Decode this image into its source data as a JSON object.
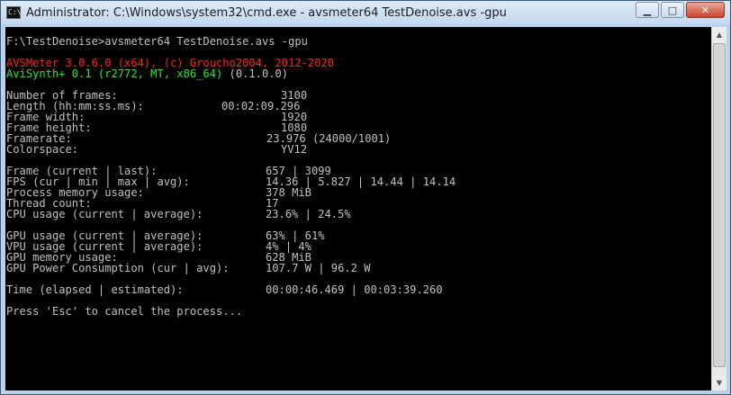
{
  "window": {
    "title": "Administrator: C:\\Windows\\system32\\cmd.exe - avsmeter64  TestDenoise.avs -gpu",
    "icon_text": "C:\\_",
    "controls": {
      "minimize": "▁",
      "maximize": "□",
      "close": "✕"
    }
  },
  "console": {
    "prompt_line": "F:\\TestDenoise>avsmeter64 TestDenoise.avs -gpu",
    "banner_red": "AVSMeter 3.0.6.0 (x64), (c) Groucho2004, 2012-2020",
    "banner_green": "AviSynth+ 0.1 (r2772, MT, x86_64)",
    "banner_version": " (0.1.0.0)",
    "info": [
      {
        "label": "Number of frames:",
        "value": "3100"
      },
      {
        "label": "Length (hh:mm:ss.ms):",
        "value": "00:02:09.296"
      },
      {
        "label": "Frame width:",
        "value": "1920"
      },
      {
        "label": "Frame height:",
        "value": "1080"
      },
      {
        "label": "Framerate:",
        "value": "23.976 (24000/1001)"
      },
      {
        "label": "Colorspace:",
        "value": "YV12"
      }
    ],
    "stats": [
      {
        "label": "Frame (current | last):",
        "value": "657 | 3099"
      },
      {
        "label": "FPS (cur | min | max | avg):",
        "value": "14.36 | 5.827 | 14.44 | 14.14"
      },
      {
        "label": "Process memory usage:",
        "value": "378 MiB"
      },
      {
        "label": "Thread count:",
        "value": "17"
      },
      {
        "label": "CPU usage (current | average):",
        "value": "23.6% | 24.5%"
      }
    ],
    "gpu": [
      {
        "label": "GPU usage (current | average):",
        "value": "63% | 61%"
      },
      {
        "label": "VPU usage (current | average):",
        "value": "4% | 4%"
      },
      {
        "label": "GPU memory usage:",
        "value": "628 MiB"
      },
      {
        "label": "GPU Power Consumption (cur | avg):",
        "value": "107.7 W | 96.2 W"
      }
    ],
    "time": {
      "label": "Time (elapsed | estimated):",
      "value": "00:00:46.469 | 00:03:39.260"
    },
    "footer": "Press 'Esc' to cancel the process..."
  }
}
